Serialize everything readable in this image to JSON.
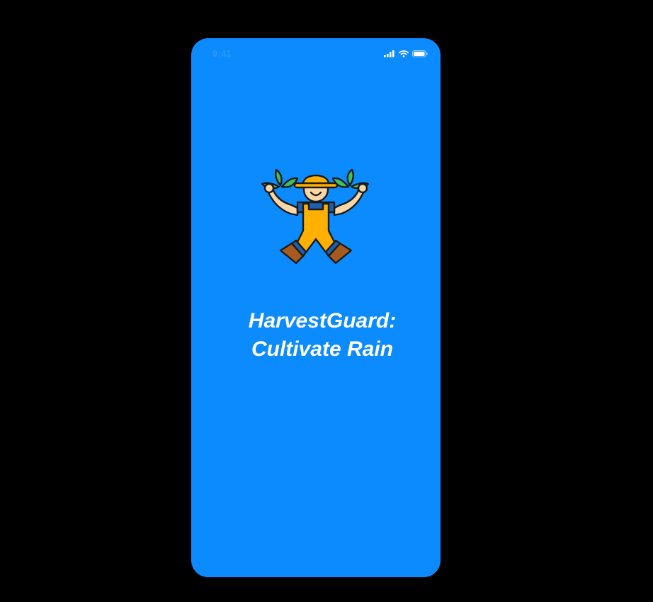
{
  "status_bar": {
    "time": "9:41",
    "icons": [
      "signal-icon",
      "wifi-icon",
      "battery-icon"
    ]
  },
  "splash": {
    "logo_icon": "farmer-icon",
    "title_line1": "HarvestGuard:",
    "title_line2": "Cultivate Rain"
  },
  "colors": {
    "background": "#0c8bff",
    "text": "#ffffff"
  }
}
